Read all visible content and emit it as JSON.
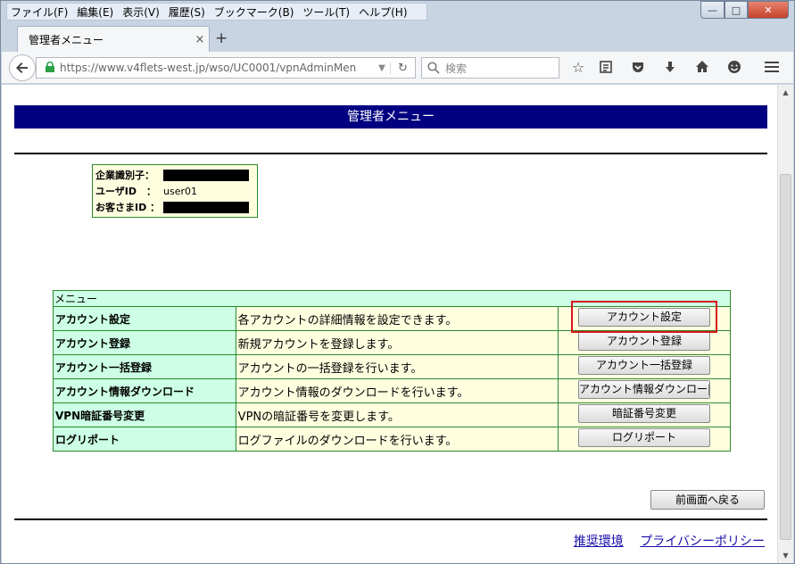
{
  "window": {
    "menu": [
      "ファイル(F)",
      "編集(E)",
      "表示(V)",
      "履歴(S)",
      "ブックマーク(B)",
      "ツール(T)",
      "ヘルプ(H)"
    ],
    "controls": {
      "minimize": "—",
      "maximize": "□",
      "close": "✕"
    }
  },
  "tab": {
    "title": "管理者メニュー",
    "close": "×",
    "new": "+"
  },
  "toolbar": {
    "url": "https://www.v4flets-west.jp/wso/UC0001/vpnAdminMen",
    "search_placeholder": "検索",
    "icons": [
      "star-icon",
      "reader-icon",
      "pocket-icon",
      "download-icon",
      "home-icon",
      "smiley-icon",
      "menu-icon"
    ]
  },
  "page": {
    "header": "管理者メニュー",
    "info": {
      "company_label": "企業識別子：",
      "user_label": "ユーザID　：",
      "user_value": "user01",
      "customer_label": "お客さまID ："
    },
    "menu_caption": "メニュー",
    "rows": [
      {
        "name": "アカウント設定",
        "desc": "各アカウントの詳細情報を設定できます。",
        "button": "アカウント設定"
      },
      {
        "name": "アカウント登録",
        "desc": "新規アカウントを登録します。",
        "button": "アカウント登録"
      },
      {
        "name": "アカウント一括登録",
        "desc": "アカウントの一括登録を行います。",
        "button": "アカウント一括登録"
      },
      {
        "name": "アカウント情報ダウンロード",
        "desc": "アカウント情報のダウンロードを行います。",
        "button": "アカウント情報ダウンロー|"
      },
      {
        "name": "VPN暗証番号変更",
        "desc": "VPNの暗証番号を変更します。",
        "button": "暗証番号変更"
      },
      {
        "name": "ログリポート",
        "desc": "ログファイルのダウンロードを行います。",
        "button": "ログリポート"
      }
    ],
    "back_button": "前画面へ戻る",
    "footer_links": [
      "推奨環境",
      "プライバシーポリシー"
    ]
  },
  "colors": {
    "header_bg": "#000080",
    "cell_green": "#ccffe5",
    "cell_yellow": "#ffffe0",
    "border_green": "#2b8a2b",
    "highlight": "#d9151b"
  }
}
